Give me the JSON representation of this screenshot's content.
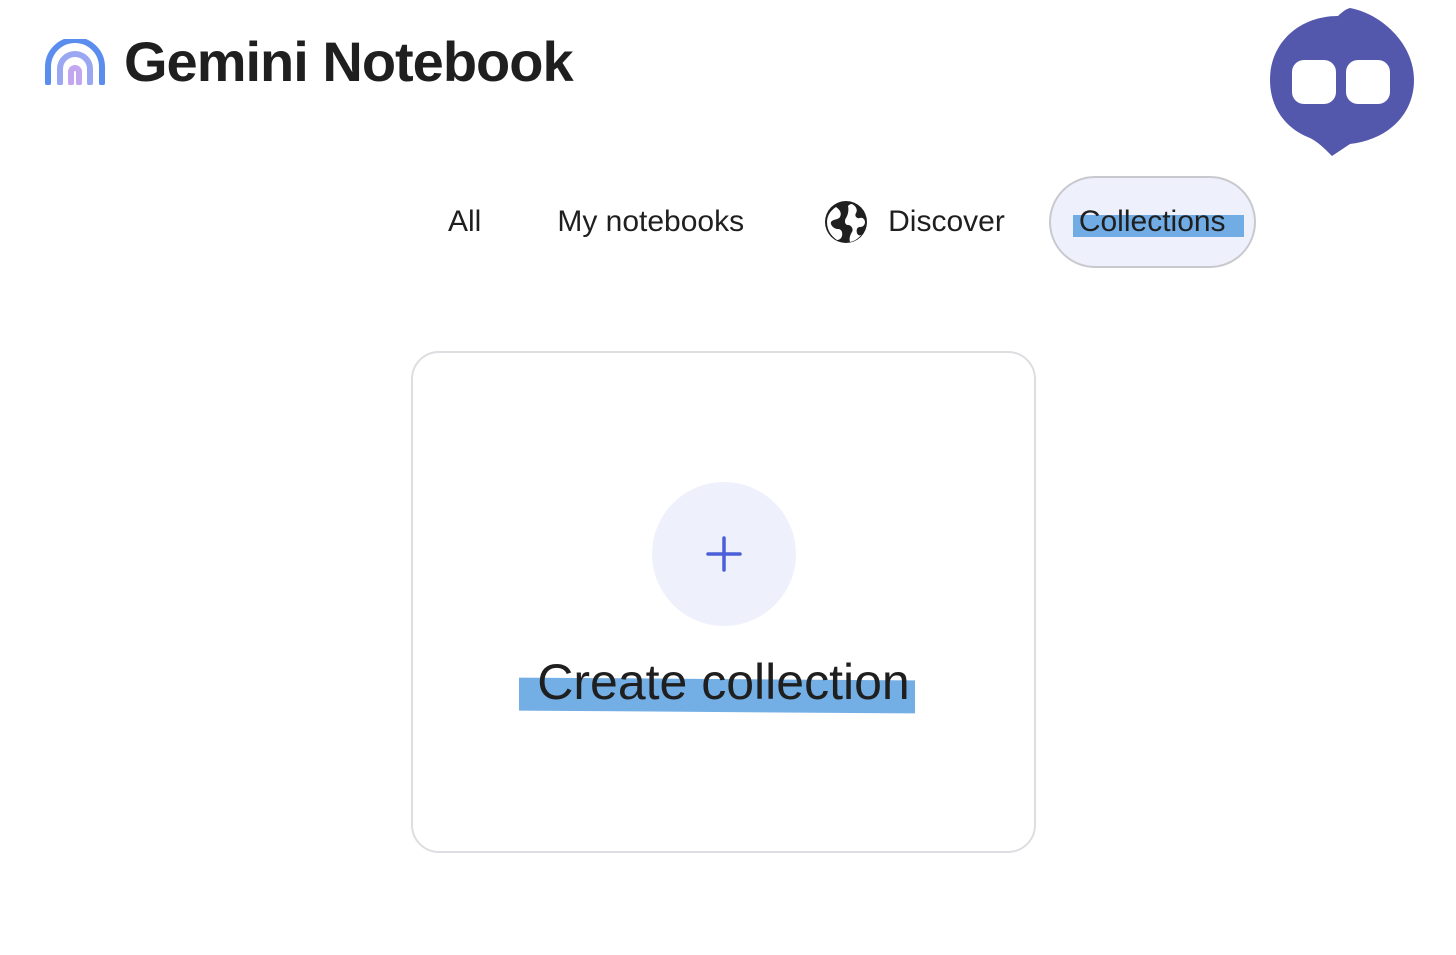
{
  "header": {
    "title": "Gemini Notebook",
    "logo_icon": "rainbow-arch-icon"
  },
  "tabs": [
    {
      "label": "All",
      "selected": false
    },
    {
      "label": "My notebooks",
      "selected": false
    },
    {
      "label": "Discover",
      "icon": "globe-icon",
      "selected": false
    },
    {
      "label": "Collections",
      "selected": true
    }
  ],
  "card": {
    "label": "Create collection",
    "icon": "plus-icon"
  },
  "badge": {
    "icon": "assistant-eyes-icon"
  },
  "colors": {
    "accent_blue": "#4a5fd8",
    "selected_tab_bg": "#eef0fb",
    "highlight": "#5aa0e0",
    "badge": "#5458ad",
    "text": "#1f1f1f"
  }
}
